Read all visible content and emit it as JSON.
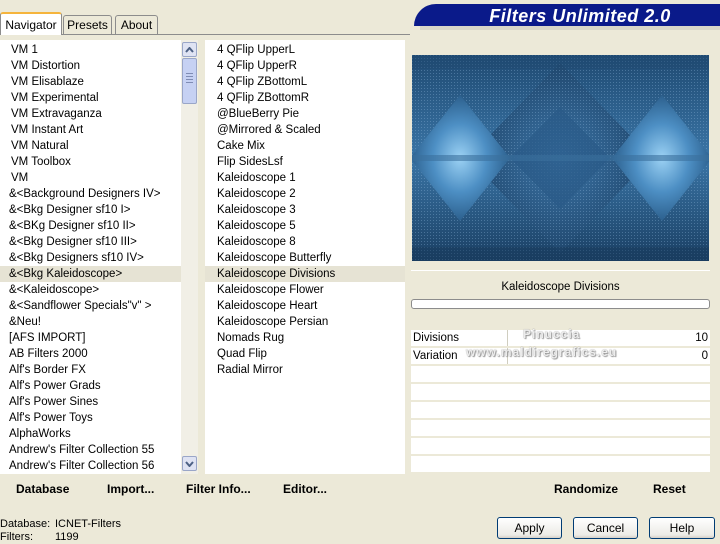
{
  "tabs": {
    "navigator": "Navigator",
    "presets": "Presets",
    "about": "About"
  },
  "app_title": "Filters Unlimited 2.0",
  "categories": [
    "VM 1",
    "VM Distortion",
    "VM Elisablaze",
    "VM Experimental",
    "VM Extravaganza",
    "VM Instant Art",
    "VM Natural",
    "VM Toolbox",
    "VM",
    "&<Background Designers IV>",
    "&<Bkg Designer sf10 I>",
    "&<BKg Designer sf10 II>",
    "&<Bkg Designer sf10 III>",
    "&<Bkg Designers sf10 IV>",
    "&<Bkg Kaleidoscope>",
    "&<Kaleidoscope>",
    "&<Sandflower Specials\"v\" >",
    "&Neu!",
    "[AFS IMPORT]",
    "AB Filters 2000",
    "Alf's Border FX",
    "Alf's Power Grads",
    "Alf's Power Sines",
    "Alf's Power Toys",
    "AlphaWorks",
    "Andrew's Filter Collection 55",
    "Andrew's Filter Collection 56"
  ],
  "selected_category_index": 14,
  "filters": [
    "4 QFlip UpperL",
    "4 QFlip UpperR",
    "4 QFlip ZBottomL",
    "4 QFlip ZBottomR",
    "@BlueBerry Pie",
    "@Mirrored & Scaled",
    "Cake Mix",
    "Flip SidesLsf",
    "Kaleidoscope 1",
    "Kaleidoscope 2",
    "Kaleidoscope 3",
    "Kaleidoscope 5",
    "Kaleidoscope 8",
    "Kaleidoscope Butterfly",
    "Kaleidoscope Divisions",
    "Kaleidoscope Flower",
    "Kaleidoscope Heart",
    "Kaleidoscope Persian",
    "Nomads Rug",
    "Quad Flip",
    "Radial Mirror"
  ],
  "selected_filter_index": 14,
  "current_filter": "Kaleidoscope Divisions",
  "params": [
    {
      "name": "Divisions",
      "value": "10"
    },
    {
      "name": "Variation",
      "value": "0"
    }
  ],
  "watermark": {
    "line1": "Pinuccia",
    "line2": "www.maldiregrafics.eu"
  },
  "toolbar": {
    "database": "Database",
    "import": "Import...",
    "filter_info": "Filter Info...",
    "editor": "Editor...",
    "randomize": "Randomize",
    "reset": "Reset"
  },
  "buttons": {
    "apply": "Apply",
    "cancel": "Cancel",
    "help": "Help"
  },
  "status": {
    "database_label": "Database:",
    "database_value": "ICNET-Filters",
    "filters_label": "Filters:",
    "filters_value": "1199"
  },
  "colors": {
    "banner": "#0a1a8a",
    "selection": "#e6e3d4",
    "preview_blue": "#2e6391"
  }
}
